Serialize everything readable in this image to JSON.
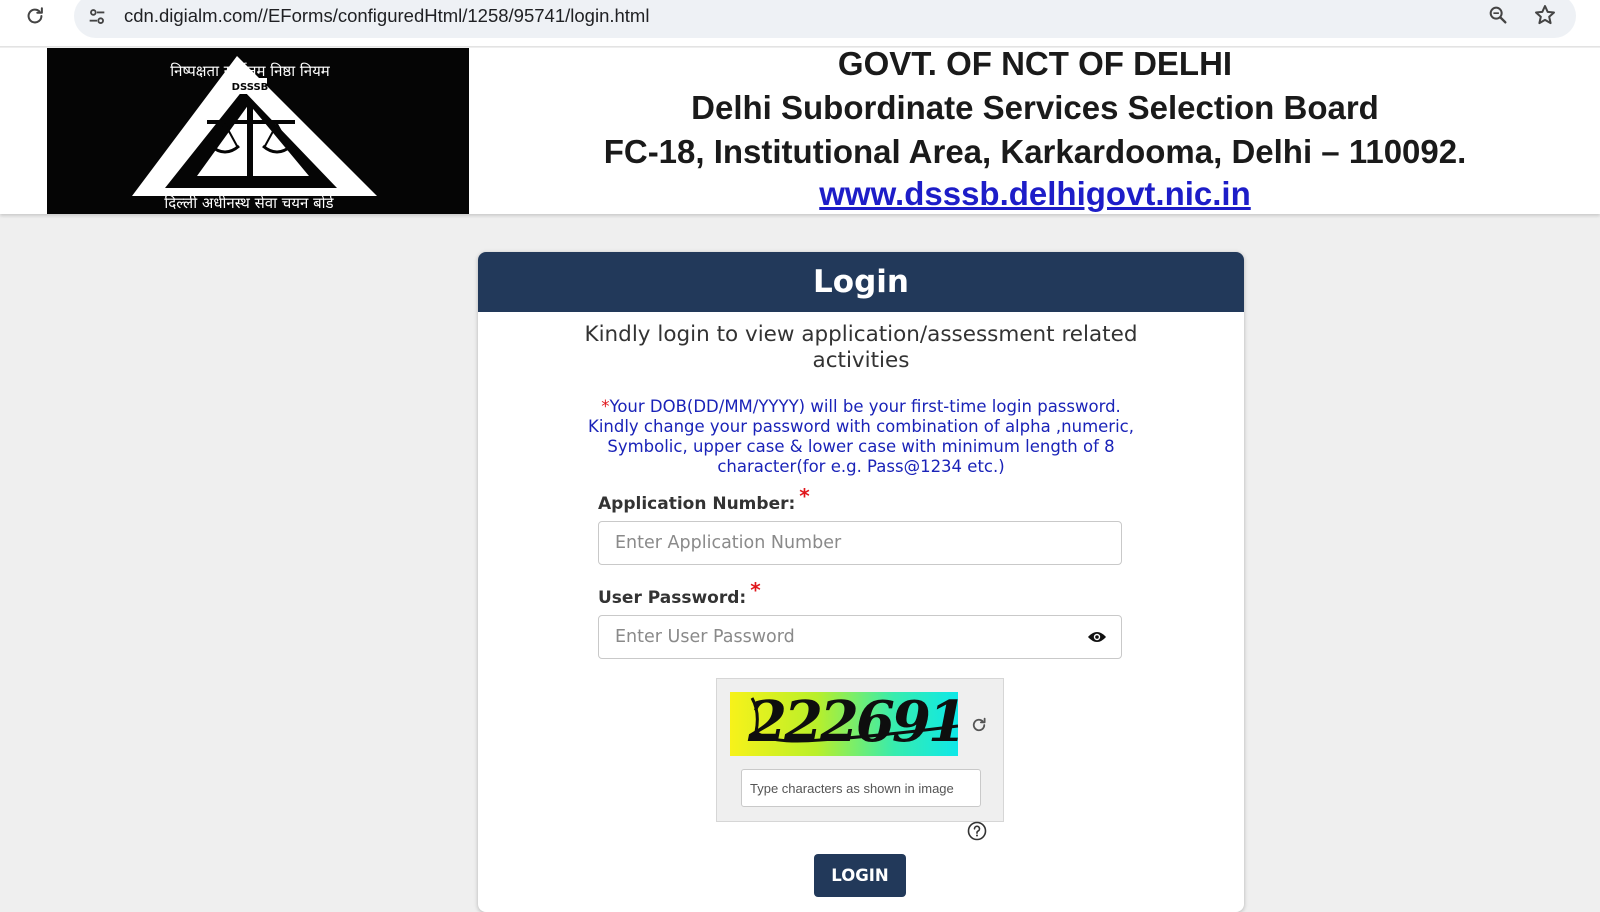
{
  "browser": {
    "url": "cdn.digialm.com//EForms/configuredHtml/1258/95741/login.html",
    "icons": [
      "reload-icon",
      "site-settings-icon",
      "zoom-icon",
      "bookmark-star-icon"
    ]
  },
  "banner": {
    "line1": "GOVT. OF NCT OF DELHI",
    "line2": "Delhi Subordinate Services Selection Board",
    "line3": "FC-18, Institutional Area, Karkardooma, Delhi – 110092.",
    "website": "www.dsssb.delhigovt.nic.in",
    "logo_tagline": "दिल्ली अधीनस्थ सेवा चयन बोर्ड",
    "logo_arc_text": "निष्पक्षता सर्वोत्तम निष्ठा नियम",
    "logo_badge": "DSSSB"
  },
  "login": {
    "title": "Login",
    "intro": "Kindly login to view application/assessment related activities",
    "note_star": "*",
    "note": "Your DOB(DD/MM/YYYY) will be your first-time login password. Kindly change your password with combination of alpha ,numeric, Symbolic, upper case & lower case with minimum length of 8 character(for e.g. Pass@1234 etc.)",
    "app_number_label": "Application Number:",
    "app_number_placeholder": "Enter Application Number",
    "app_number_value": "",
    "password_label": "User Password:",
    "password_placeholder": "Enter User Password",
    "password_value": "",
    "required_mark": "*",
    "captcha_text": "222691",
    "captcha_placeholder": "Type characters as shown in image",
    "submit_label": "LOGIN"
  },
  "colors": {
    "header_bg": "#22395a",
    "note_text": "#1a23b8",
    "required": "#e0161b",
    "link": "#1d1dc8",
    "page_bg": "#efefef"
  }
}
